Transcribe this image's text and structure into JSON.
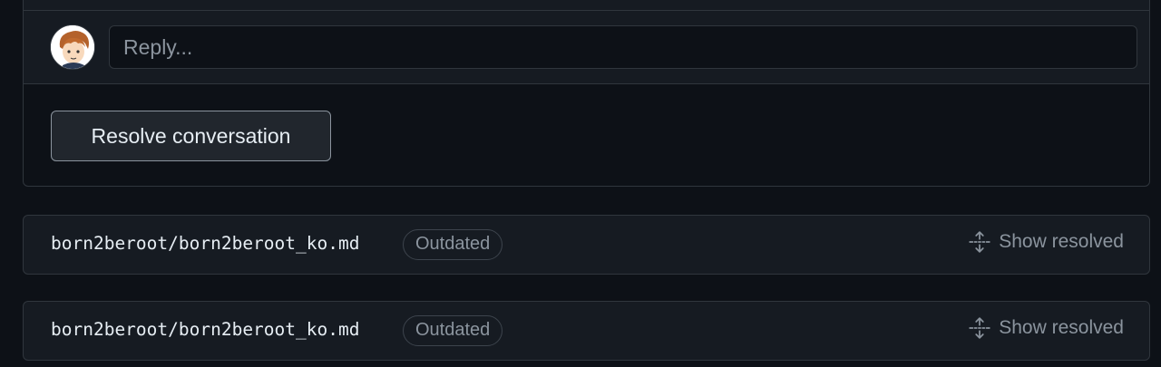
{
  "reply": {
    "placeholder": "Reply..."
  },
  "thread": {
    "resolve_label": "Resolve conversation"
  },
  "files": [
    {
      "path": "born2beroot/born2beroot_ko.md",
      "badge": "Outdated",
      "action": "Show resolved"
    },
    {
      "path": "born2beroot/born2beroot_ko.md",
      "badge": "Outdated",
      "action": "Show resolved"
    }
  ],
  "icons": {
    "avatar": "user-avatar",
    "show_resolved": "unfold-icon"
  },
  "colors": {
    "background": "#0d1117",
    "surface": "#161b22",
    "border": "#30363d",
    "text": "#e6edf3",
    "muted": "#8b949e"
  }
}
